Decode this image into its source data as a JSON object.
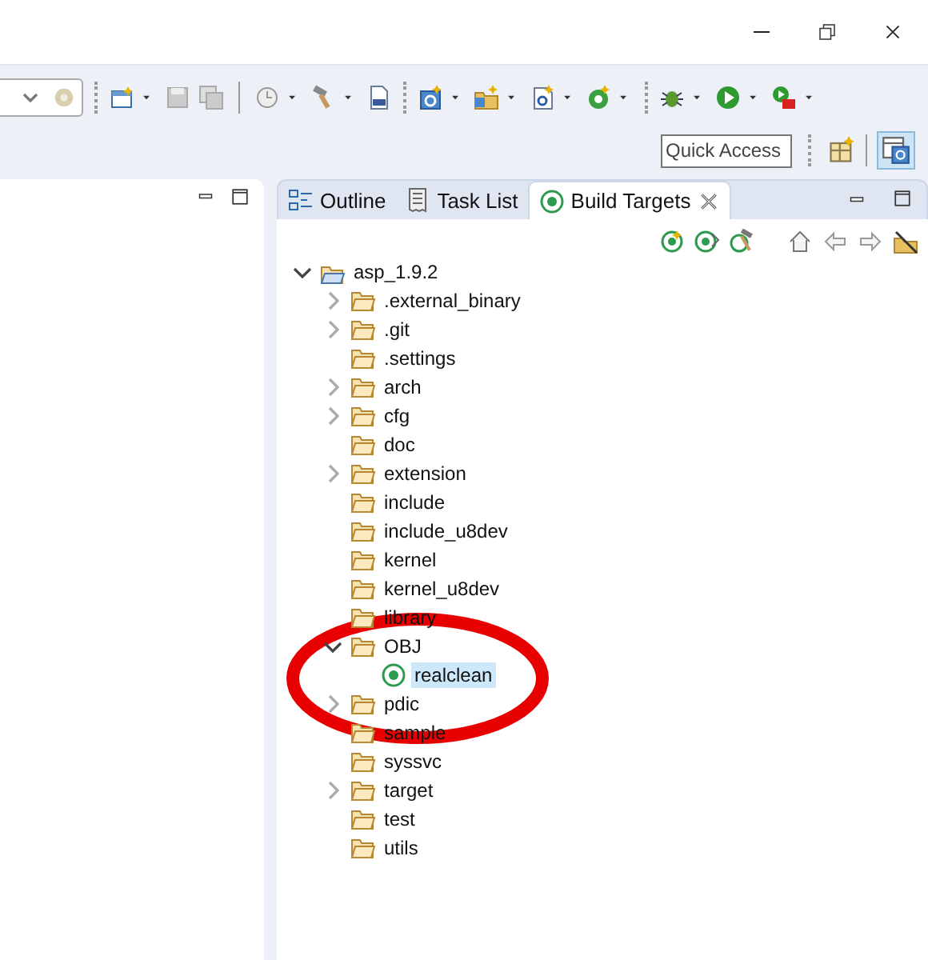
{
  "quick_access": {
    "placeholder": "Quick Access"
  },
  "view_tabs": [
    {
      "label": "Outline",
      "kind": "outline",
      "selected": false
    },
    {
      "label": "Task List",
      "kind": "tasks",
      "selected": false
    },
    {
      "label": "Build Targets",
      "kind": "targets",
      "selected": true
    }
  ],
  "tree": [
    {
      "label": "asp_1.9.2",
      "kind": "project",
      "expandable": true,
      "expanded": true,
      "selected": false,
      "children": [
        {
          "label": ".external_binary",
          "kind": "folder",
          "expandable": true,
          "expanded": false,
          "selected": false
        },
        {
          "label": ".git",
          "kind": "folder",
          "expandable": true,
          "expanded": false,
          "selected": false
        },
        {
          "label": ".settings",
          "kind": "folder",
          "expandable": false,
          "expanded": false,
          "selected": false
        },
        {
          "label": "arch",
          "kind": "folder",
          "expandable": true,
          "expanded": false,
          "selected": false
        },
        {
          "label": "cfg",
          "kind": "folder",
          "expandable": true,
          "expanded": false,
          "selected": false
        },
        {
          "label": "doc",
          "kind": "folder",
          "expandable": false,
          "expanded": false,
          "selected": false
        },
        {
          "label": "extension",
          "kind": "folder",
          "expandable": true,
          "expanded": false,
          "selected": false
        },
        {
          "label": "include",
          "kind": "folder",
          "expandable": false,
          "expanded": false,
          "selected": false
        },
        {
          "label": "include_u8dev",
          "kind": "folder",
          "expandable": false,
          "expanded": false,
          "selected": false
        },
        {
          "label": "kernel",
          "kind": "folder",
          "expandable": false,
          "expanded": false,
          "selected": false
        },
        {
          "label": "kernel_u8dev",
          "kind": "folder",
          "expandable": false,
          "expanded": false,
          "selected": false
        },
        {
          "label": "library",
          "kind": "folder",
          "expandable": false,
          "expanded": false,
          "selected": false
        },
        {
          "label": "OBJ",
          "kind": "folder",
          "expandable": true,
          "expanded": true,
          "selected": false,
          "children": [
            {
              "label": "realclean",
              "kind": "target",
              "expandable": false,
              "expanded": false,
              "selected": true
            }
          ]
        },
        {
          "label": "pdic",
          "kind": "folder",
          "expandable": true,
          "expanded": false,
          "selected": false
        },
        {
          "label": "sample",
          "kind": "folder",
          "expandable": false,
          "expanded": false,
          "selected": false
        },
        {
          "label": "syssvc",
          "kind": "folder",
          "expandable": false,
          "expanded": false,
          "selected": false
        },
        {
          "label": "target",
          "kind": "folder",
          "expandable": true,
          "expanded": false,
          "selected": false
        },
        {
          "label": "test",
          "kind": "folder",
          "expandable": false,
          "expanded": false,
          "selected": false
        },
        {
          "label": "utils",
          "kind": "folder",
          "expandable": false,
          "expanded": false,
          "selected": false
        }
      ]
    }
  ],
  "annotation": {
    "kind": "ellipse",
    "color": "#e80000"
  }
}
